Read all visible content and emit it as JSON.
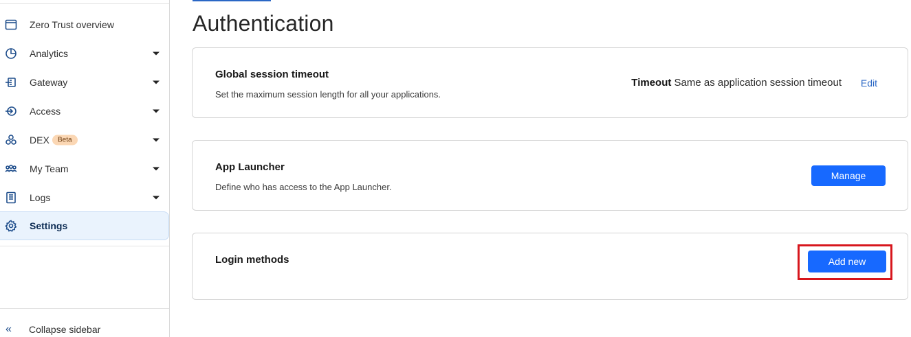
{
  "sidebar": {
    "items": [
      {
        "label": "Zero Trust overview",
        "icon": "browser-window-icon",
        "has_caret": false
      },
      {
        "label": "Analytics",
        "icon": "pie-chart-icon",
        "has_caret": true
      },
      {
        "label": "Gateway",
        "icon": "gateway-icon",
        "has_caret": true
      },
      {
        "label": "Access",
        "icon": "access-icon",
        "has_caret": true
      },
      {
        "label": "DEX",
        "icon": "dex-icon",
        "has_caret": true,
        "badge": "Beta"
      },
      {
        "label": "My Team",
        "icon": "team-icon",
        "has_caret": true
      },
      {
        "label": "Logs",
        "icon": "logs-icon",
        "has_caret": true
      },
      {
        "label": "Settings",
        "icon": "gear-icon",
        "has_caret": false,
        "active": true
      }
    ],
    "collapse_label": "Collapse sidebar"
  },
  "main": {
    "title": "Authentication",
    "cards": {
      "global_session": {
        "title": "Global session timeout",
        "description": "Set the maximum session length for all your applications.",
        "timeout_label": "Timeout",
        "timeout_value": "Same as application session timeout",
        "edit_label": "Edit"
      },
      "app_launcher": {
        "title": "App Launcher",
        "description": "Define who has access to the App Launcher.",
        "button_label": "Manage"
      },
      "login_methods": {
        "title": "Login methods",
        "button_label": "Add new"
      }
    }
  },
  "colors": {
    "primary_button": "#1769ff",
    "link": "#2a67c5",
    "highlight_box": "#d7161d",
    "active_nav_bg": "#eaf3fd",
    "beta_badge_bg": "#fbd7b4"
  }
}
